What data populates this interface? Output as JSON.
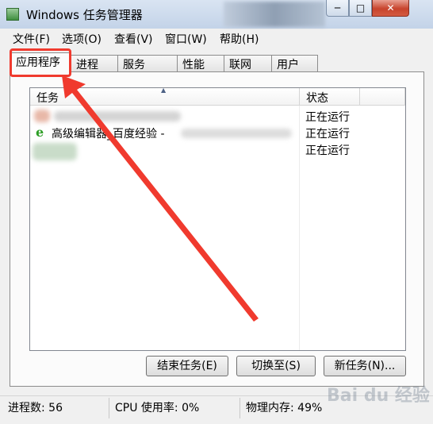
{
  "window": {
    "title": "Windows 任务管理器",
    "controls": {
      "minimize": "─",
      "maximize": "□",
      "close": "✕"
    }
  },
  "menu": [
    "文件(F)",
    "选项(O)",
    "查看(V)",
    "窗口(W)",
    "帮助(H)"
  ],
  "tabs": [
    {
      "label": "应用程序",
      "active": true
    },
    {
      "label": "进程",
      "active": false
    },
    {
      "label": "服务",
      "active": false
    },
    {
      "label": "性能",
      "active": false
    },
    {
      "label": "联网",
      "active": false
    },
    {
      "label": "用户",
      "active": false
    }
  ],
  "columns": {
    "task": "任务",
    "status": "状态"
  },
  "rows": [
    {
      "name": "",
      "status": "正在运行",
      "icon": "blurred"
    },
    {
      "name": "高级编辑器_百度经验 -",
      "status": "正在运行",
      "icon": "ie-icon"
    },
    {
      "name": "",
      "status": "正在运行",
      "icon": "blurred"
    }
  ],
  "buttons": {
    "end_task": "结束任务(E)",
    "switch_to": "切换至(S)",
    "new_task": "新任务(N)..."
  },
  "statusbar": {
    "processes": "进程数: 56",
    "cpu": "CPU 使用率: 0%",
    "memory": "物理内存: 49%"
  },
  "colors": {
    "annotation": "#f03a2e",
    "ie_icon": "#2c9e25"
  }
}
